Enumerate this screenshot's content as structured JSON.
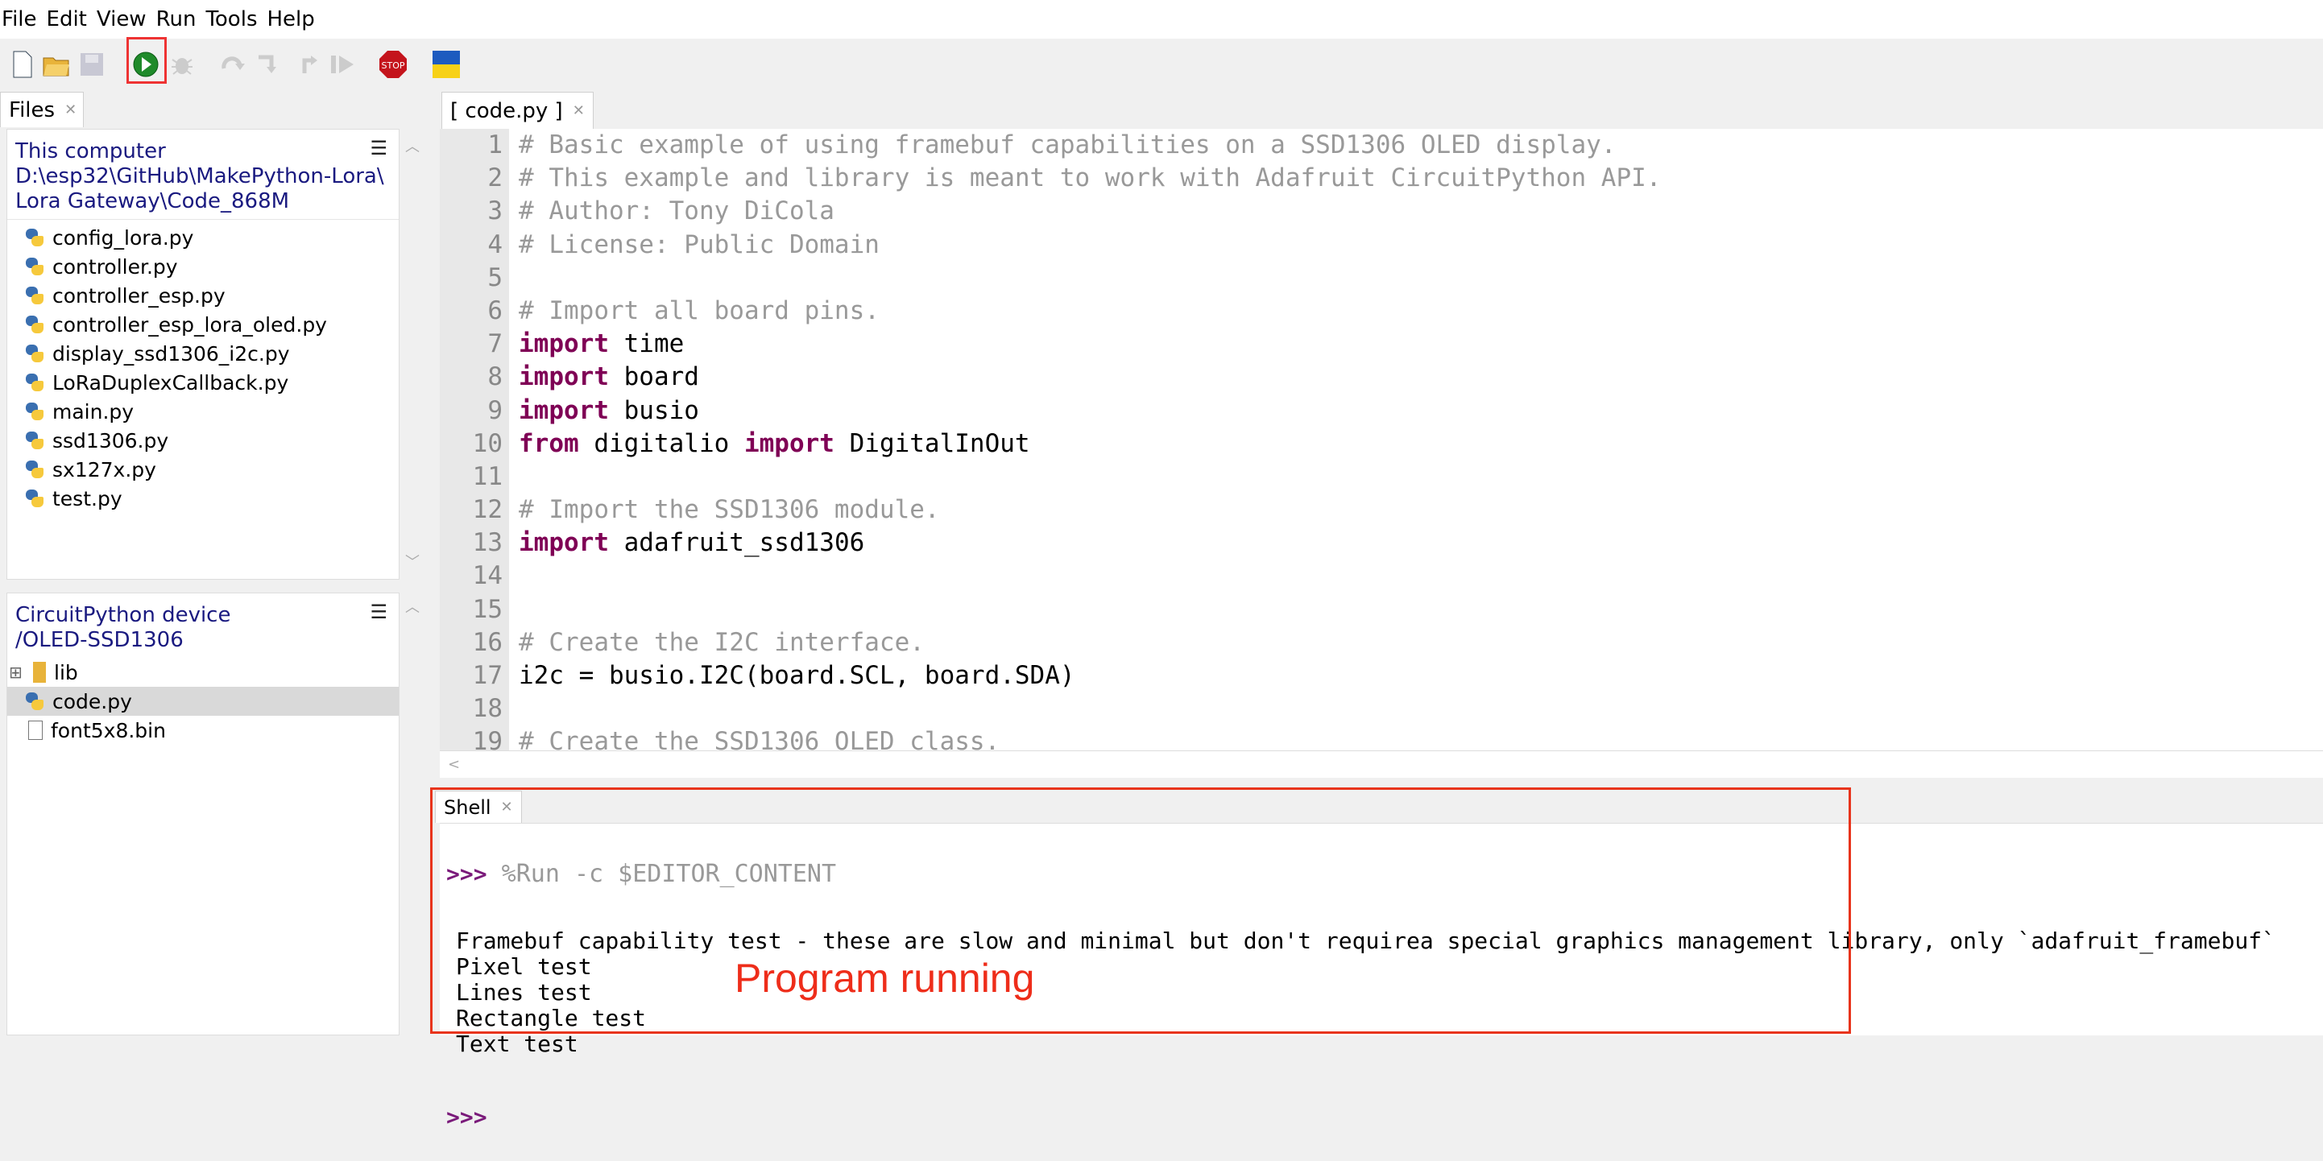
{
  "menu": [
    "File",
    "Edit",
    "View",
    "Run",
    "Tools",
    "Help"
  ],
  "toolbar": {
    "icons": [
      "new-file-icon",
      "open-folder-icon",
      "save-icon",
      "run-icon",
      "debug-icon",
      "step-over-icon",
      "step-into-icon",
      "step-out-icon",
      "resume-icon",
      "stop-icon",
      "ukraine-flag-icon"
    ],
    "stop_label": "STOP",
    "highlighted": "run-icon"
  },
  "files_tab": {
    "label": "Files"
  },
  "this_computer": {
    "title": "This computer",
    "path_line1": "D:\\esp32\\GitHub\\MakePython-Lora\\",
    "path_line2": "Lora Gateway\\Code_868M",
    "files": [
      "config_lora.py",
      "controller.py",
      "controller_esp.py",
      "controller_esp_lora_oled.py",
      "display_ssd1306_i2c.py",
      "LoRaDuplexCallback.py",
      "main.py",
      "ssd1306.py",
      "sx127x.py",
      "test.py"
    ]
  },
  "device": {
    "title": "CircuitPython device",
    "path": "/OLED-SSD1306",
    "items": [
      {
        "name": "lib",
        "type": "folder"
      },
      {
        "name": "code.py",
        "type": "python",
        "selected": true
      },
      {
        "name": "font5x8.bin",
        "type": "file"
      }
    ]
  },
  "editor": {
    "tab": "[ code.py ]",
    "lines": [
      {
        "n": "1",
        "t": "# Basic example of using framebuf capabilities on a SSD1306 OLED display.",
        "k": "cm"
      },
      {
        "n": "2",
        "t": "# This example and library is meant to work with Adafruit CircuitPython API.",
        "k": "cm"
      },
      {
        "n": "3",
        "t": "# Author: Tony DiCola",
        "k": "cm"
      },
      {
        "n": "4",
        "t": "# License: Public Domain",
        "k": "cm"
      },
      {
        "n": "5",
        "t": "",
        "k": ""
      },
      {
        "n": "6",
        "t": "# Import all board pins.",
        "k": "cm"
      },
      {
        "n": "7",
        "kw": "import",
        "t": " time",
        "k": ""
      },
      {
        "n": "8",
        "kw": "import",
        "t": " board",
        "k": ""
      },
      {
        "n": "9",
        "kw": "import",
        "t": " busio",
        "k": ""
      },
      {
        "n": "10",
        "kw": "from",
        "t": " digitalio ",
        "kw2": "import",
        "t2": " DigitalInOut",
        "k": ""
      },
      {
        "n": "11",
        "t": "",
        "k": ""
      },
      {
        "n": "12",
        "t": "# Import the SSD1306 module.",
        "k": "cm"
      },
      {
        "n": "13",
        "kw": "import",
        "t": " adafruit_ssd1306",
        "k": ""
      },
      {
        "n": "14",
        "t": "",
        "k": ""
      },
      {
        "n": "15",
        "t": "",
        "k": ""
      },
      {
        "n": "16",
        "t": "# Create the I2C interface.",
        "k": "cm"
      },
      {
        "n": "17",
        "t": "i2c = busio.I2C(board.SCL, board.SDA)",
        "k": ""
      },
      {
        "n": "18",
        "t": "",
        "k": ""
      },
      {
        "n": "19",
        "t": "# Create the SSD1306 OLED class.",
        "k": "cm"
      }
    ]
  },
  "shell": {
    "tab": "Shell",
    "prompt": ">>>",
    "command": " %Run -c $EDITOR_CONTENT",
    "output": [
      "Framebuf capability test - these are slow and minimal but don't requirea special graphics management library, only `adafruit_framebuf`",
      "Pixel test",
      "Lines test",
      "Rectangle test",
      "Text test"
    ]
  },
  "annotation": "Program running"
}
